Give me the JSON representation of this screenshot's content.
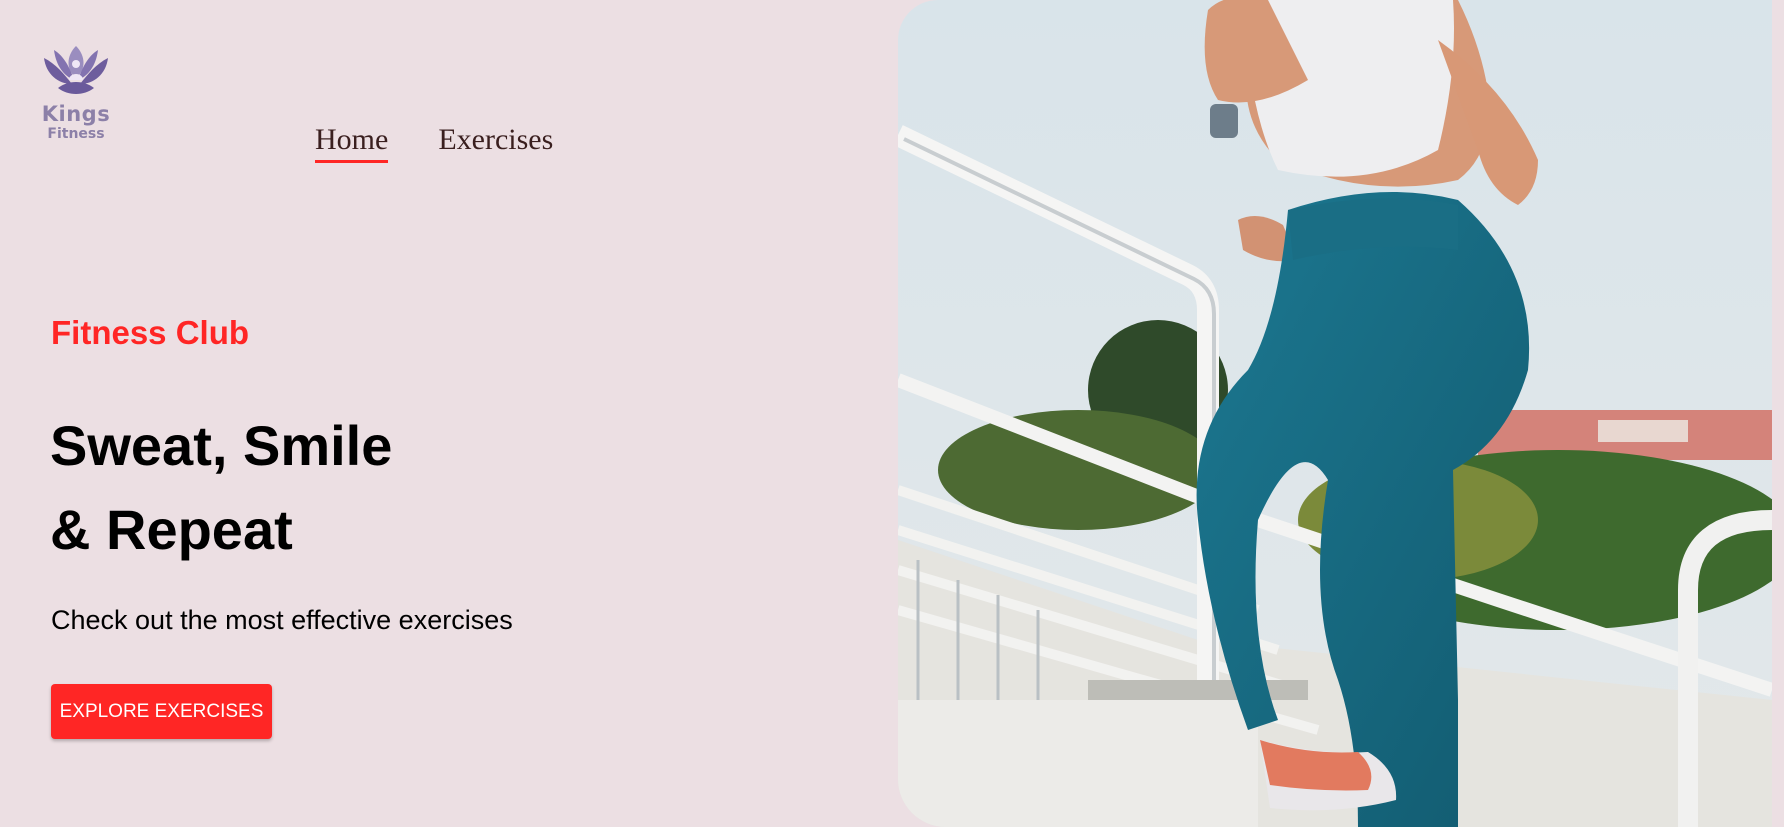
{
  "logo": {
    "line1": "Kings",
    "line2": "Fitness",
    "icon": "lotus-meditation-icon"
  },
  "nav": {
    "items": [
      {
        "label": "Home",
        "active": true
      },
      {
        "label": "Exercises",
        "active": false
      }
    ]
  },
  "hero": {
    "tagline": "Fitness Club",
    "headline_line1": "Sweat, Smile",
    "headline_line2": "& Repeat",
    "subtitle": "Check out the most effective exercises",
    "cta_label": "EXPLORE EXERCISES",
    "image": "woman-running-up-stadium-stairs"
  },
  "colors": {
    "accent": "#ff2625",
    "background": "#ecdfe3",
    "logo": "#8c80a8"
  }
}
